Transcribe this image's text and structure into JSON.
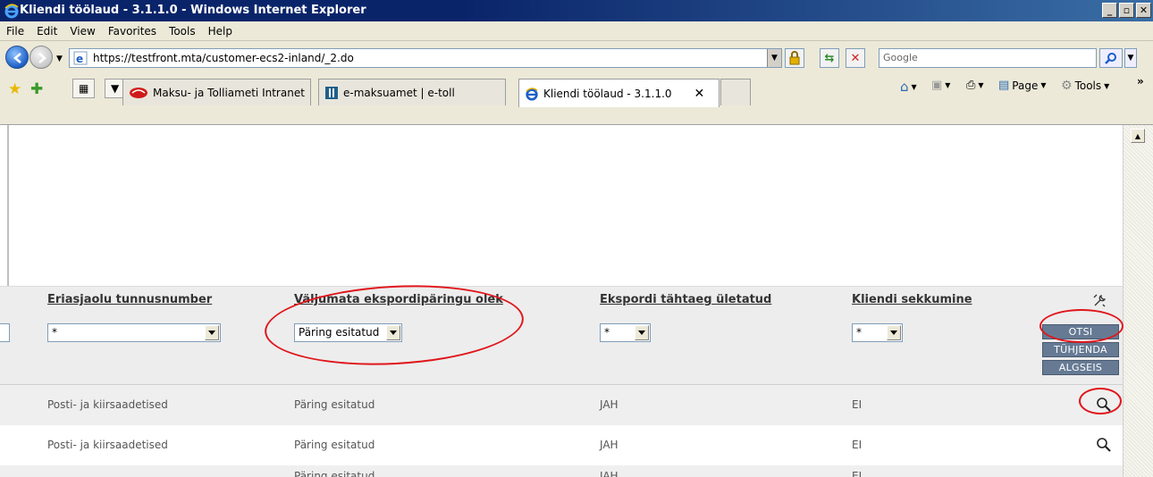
{
  "window": {
    "title": "Kliendi töölaud - 3.1.1.0 - Windows Internet Explorer",
    "buttons": [
      "_",
      "▫",
      "✕"
    ]
  },
  "menu": [
    "File",
    "Edit",
    "View",
    "Favorites",
    "Tools",
    "Help"
  ],
  "address": {
    "url": "https://testfront.mta/customer-ecs2-inland/_2.do",
    "search_placeholder": "Google"
  },
  "tabs": [
    {
      "label": "Maksu- ja Tolliameti Intranet",
      "icon": "mta-logo-icon"
    },
    {
      "label": "e-maksuamet | e-toll",
      "icon": "etoll-logo-icon"
    },
    {
      "label": "Kliendi töölaud - 3.1.1.0",
      "icon": "ie-icon",
      "active": true
    }
  ],
  "commands": {
    "page": "Page",
    "tools": "Tools",
    "more": "»"
  },
  "table": {
    "headers": [
      "Eriasjaolu tunnusnumber",
      "Väljumata ekspordipäringu olek",
      "Ekspordi tähtaeg ületatud",
      "Kliendi sekkumine"
    ],
    "filters": [
      "*",
      "Päring esitatud",
      "*",
      "*"
    ],
    "buttons": {
      "search": "OTSI",
      "clear": "TÜHJENDA",
      "reset": "ALGSEIS"
    },
    "rows": [
      [
        "Posti- ja kiirsaadetised",
        "Päring esitatud",
        "JAH",
        "EI"
      ],
      [
        "Posti- ja kiirsaadetised",
        "Päring esitatud",
        "JAH",
        "EI"
      ],
      [
        "",
        "Päring esitatud",
        "JAH",
        "EI"
      ]
    ]
  },
  "colors": {
    "titlebar": "#0a246a",
    "button": "#667a94",
    "annotation": "#e0161b"
  }
}
